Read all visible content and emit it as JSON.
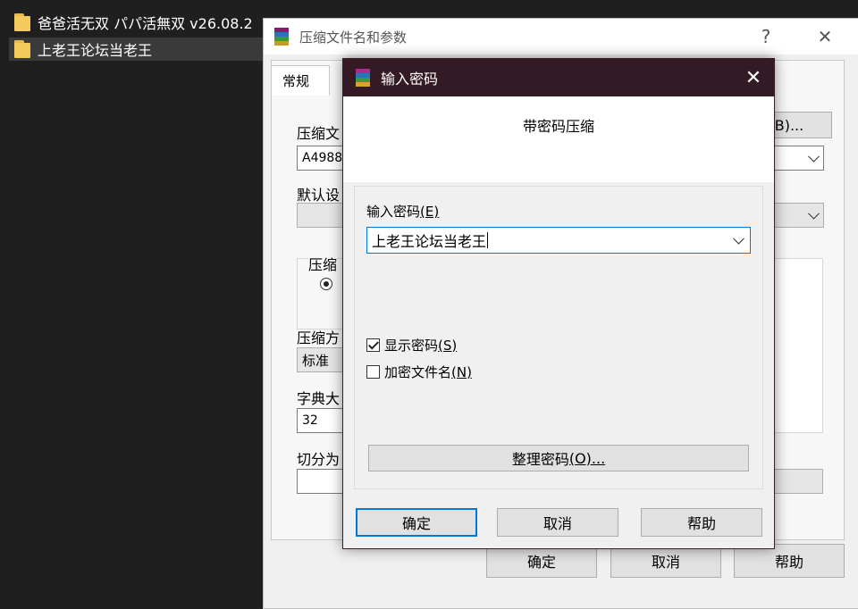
{
  "explorer": {
    "files": [
      {
        "name": "爸爸活无双 パパ活無双 v26.08.2",
        "selected": false
      },
      {
        "name": "上老王论坛当老王",
        "selected": true
      }
    ]
  },
  "archive_dialog": {
    "title": "压缩文件名和参数",
    "help_glyph": "?",
    "close_glyph": "✕",
    "tab_general": "常规",
    "archive_name_label": "压缩文",
    "browse_button": "B)...",
    "archive_name_value": "A4988",
    "profile_label": "默认设",
    "format_group_label": "压缩",
    "method_label": "压缩方",
    "method_value": "标准",
    "dict_label": "字典大",
    "dict_value": "32",
    "split_label": "切分为",
    "ok": "确定",
    "cancel": "取消",
    "help": "帮助"
  },
  "password_dialog": {
    "title": "输入密码",
    "close_glyph": "✕",
    "header": "带密码压缩",
    "enter_label": "输入密码",
    "enter_accel": "(E)",
    "password_value": "上老王论坛当老王",
    "show_password_label": "显示密码",
    "show_password_accel": "(S)",
    "show_password_checked": true,
    "encrypt_names_label": "加密文件名",
    "encrypt_names_accel": "(N)",
    "encrypt_names_checked": false,
    "organize_button": "整理密码",
    "organize_accel": "(O)...",
    "ok": "确定",
    "cancel": "取消",
    "help": "帮助"
  }
}
